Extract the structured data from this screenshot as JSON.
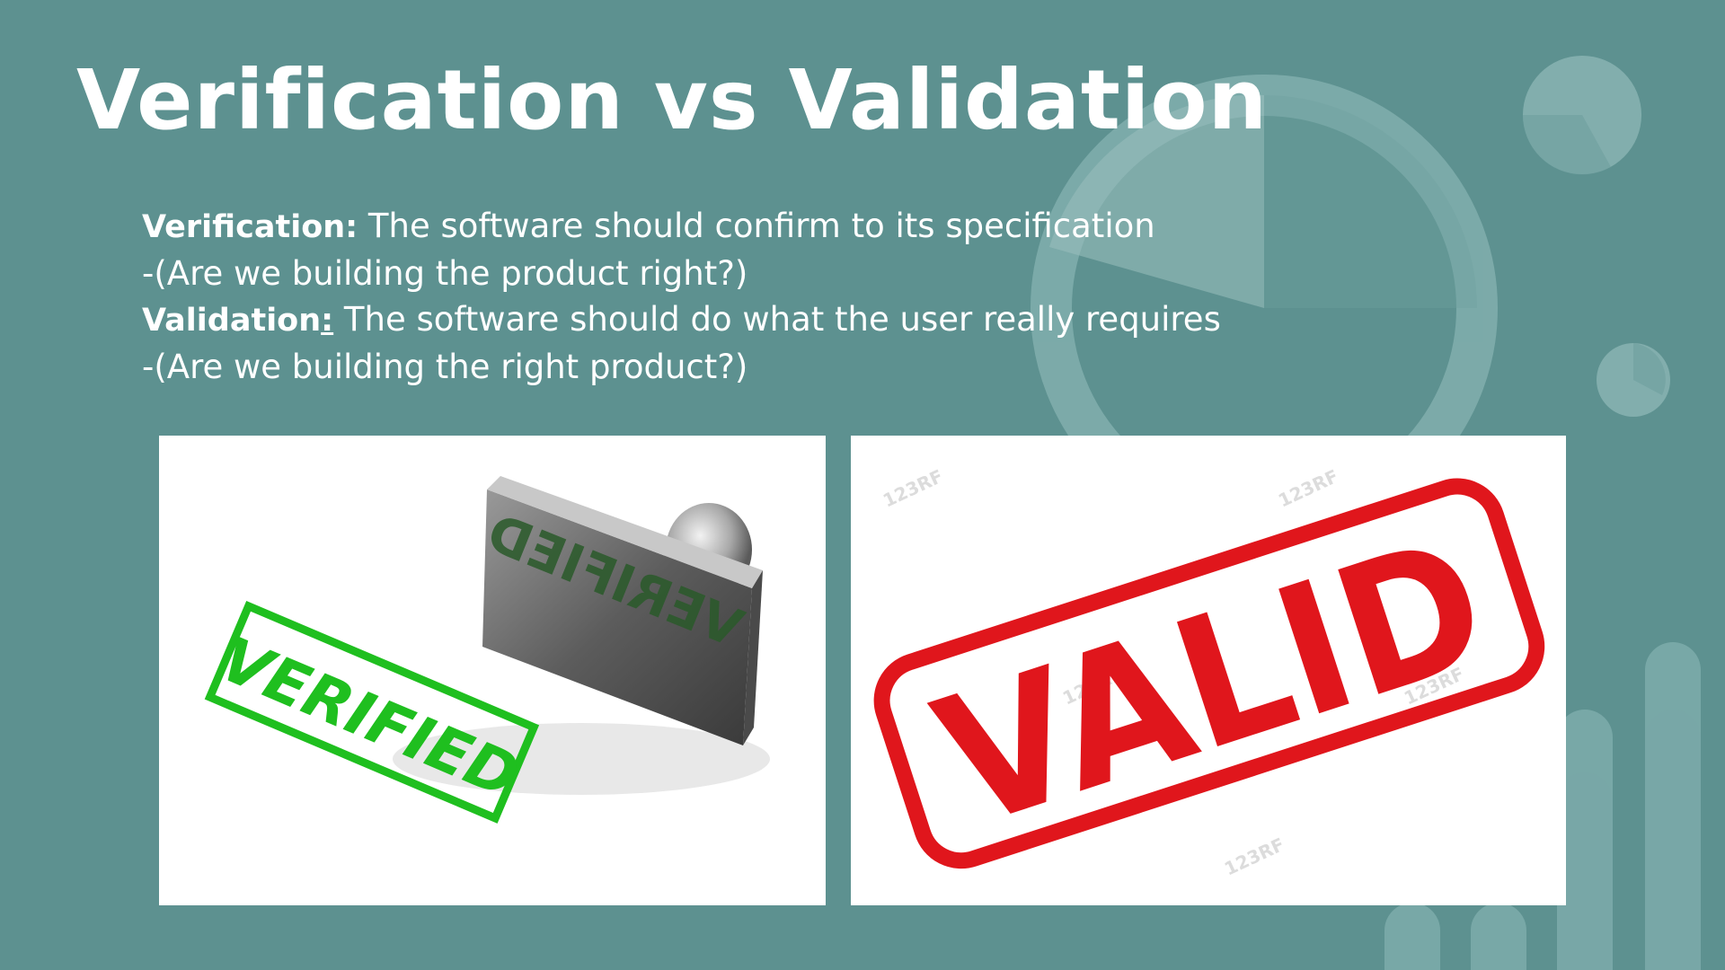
{
  "slide": {
    "title": "Verification vs Validation",
    "lines": [
      {
        "term": "Verification:",
        "sep": "",
        "text": " The software should confirm to its specification"
      },
      {
        "text": "-(Are we building the product right?)"
      },
      {
        "term": "Validation",
        "sep": ":",
        "text": " The software should do what the user really requires"
      },
      {
        "text": "-(Are we building the right product?)"
      }
    ]
  },
  "images": {
    "verified": {
      "stamp_text": "VERIFIED",
      "stamp_color": "#1fbf1f",
      "icon": "rubber-stamp-icon"
    },
    "valid": {
      "stamp_text": "VALID",
      "stamp_color": "#e0161c",
      "watermark": "123RF"
    }
  },
  "colors": {
    "background": "#5d9190",
    "text": "#ffffff"
  }
}
